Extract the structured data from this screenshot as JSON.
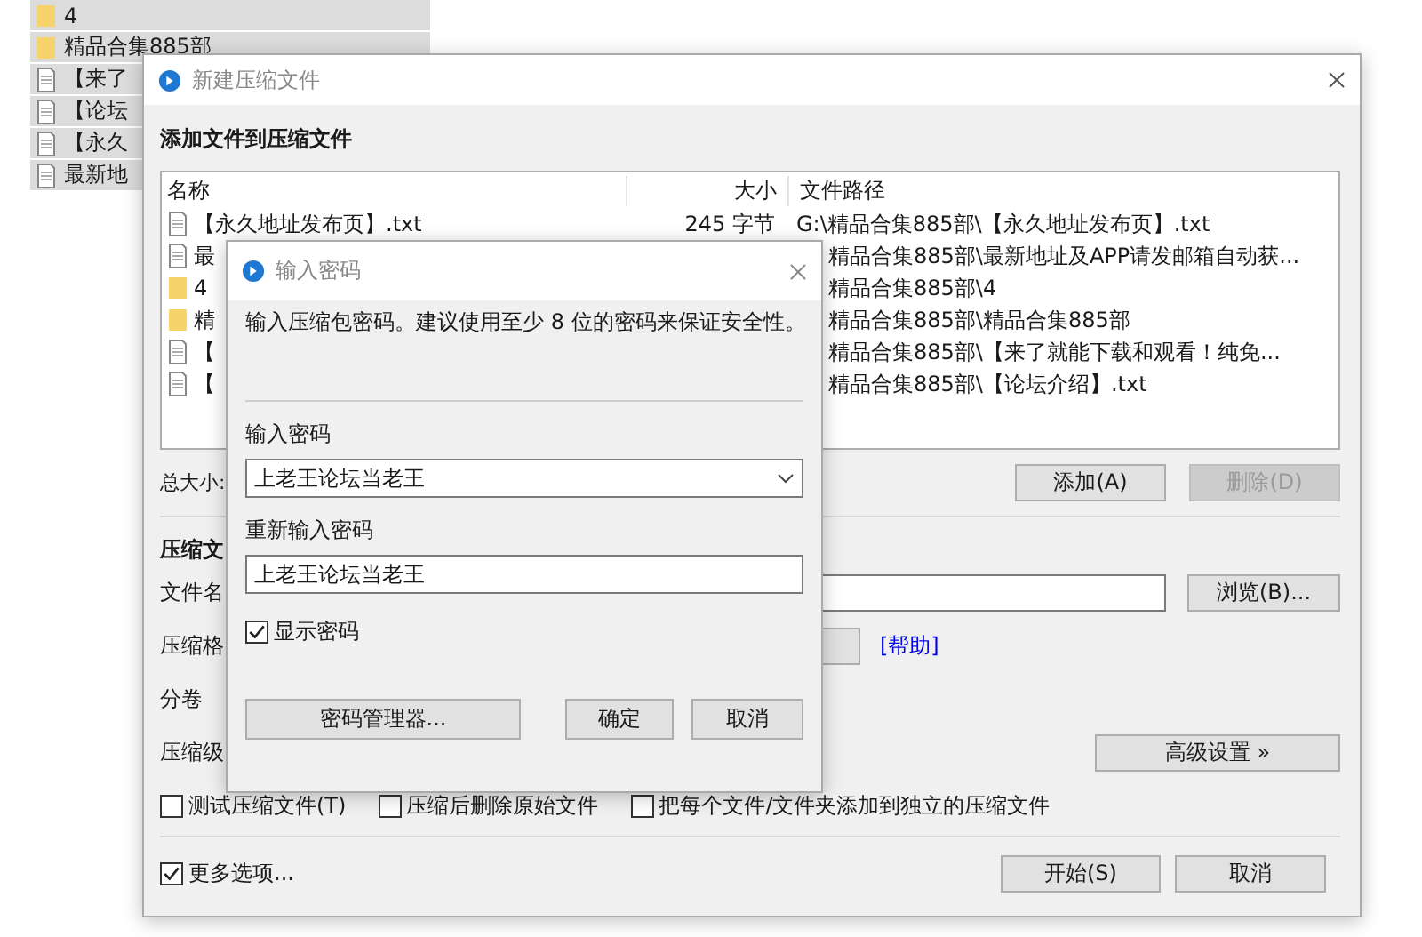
{
  "explorer_items": [
    {
      "kind": "folder",
      "name": "4"
    },
    {
      "kind": "folder",
      "name": "精品合集885部"
    },
    {
      "kind": "file",
      "name": "【来了"
    },
    {
      "kind": "file",
      "name": "【论坛"
    },
    {
      "kind": "file",
      "name": "【永久"
    },
    {
      "kind": "file",
      "name": "最新地"
    }
  ],
  "main_dialog": {
    "title": "新建压缩文件",
    "heading": "添加文件到压缩文件",
    "file_list": {
      "columns": [
        "名称",
        "大小",
        "文件路径"
      ],
      "rows": [
        {
          "kind": "file",
          "covered": false,
          "name": "【永久地址发布页】.txt",
          "size": "245 字节",
          "path": "G:\\精品合集885部\\【永久地址发布页】.txt"
        },
        {
          "kind": "file",
          "covered": true,
          "name": "最",
          "path": "精品合集885部\\最新地址及APP请发邮箱自动获..."
        },
        {
          "kind": "folder",
          "covered": true,
          "name": "4",
          "path": "精品合集885部\\4"
        },
        {
          "kind": "folder",
          "covered": true,
          "name": "精",
          "path": "精品合集885部\\精品合集885部"
        },
        {
          "kind": "file",
          "covered": true,
          "name": "【",
          "path": "精品合集885部\\【来了就能下载和观看！纯免..."
        },
        {
          "kind": "file",
          "covered": true,
          "name": "【",
          "path": "精品合集885部\\【论坛介绍】.txt"
        }
      ]
    },
    "total_label": "总大小:",
    "list_buttons": [
      {
        "label": "添加(A)",
        "disabled": false
      },
      {
        "label": "删除(D)",
        "disabled": true
      }
    ],
    "section_title": "压缩文",
    "fields": [
      {
        "kind": "text",
        "label": "文件名",
        "button": "浏览(B)..."
      },
      {
        "kind": "select",
        "label": "压缩格",
        "link": "[帮助]"
      },
      {
        "kind": "plain",
        "label": "分卷"
      },
      {
        "kind": "button",
        "label": "压缩级",
        "button": "高级设置 »"
      }
    ],
    "options": [
      {
        "label": "测试压缩文件(T)",
        "checked": false
      },
      {
        "label": "压缩后删除原始文件",
        "checked": false
      },
      {
        "label": "把每个文件/文件夹添加到独立的压缩文件",
        "checked": false
      }
    ],
    "more_options": {
      "label": "更多选项...",
      "checked": true
    },
    "buttons": [
      "开始(S)",
      "取消"
    ]
  },
  "password_dialog": {
    "title": "输入密码",
    "message": "输入压缩包密码。建议使用至少 8 位的密码来保证安全性。",
    "password_label": "输入密码",
    "password": "上老王论坛当老王",
    "repeat_label": "重新输入密码",
    "repeat": "上老王论坛当老王",
    "show_password": {
      "label": "显示密码",
      "checked": true
    },
    "manager_button": "密码管理器...",
    "buttons": [
      "确定",
      "取消"
    ]
  }
}
